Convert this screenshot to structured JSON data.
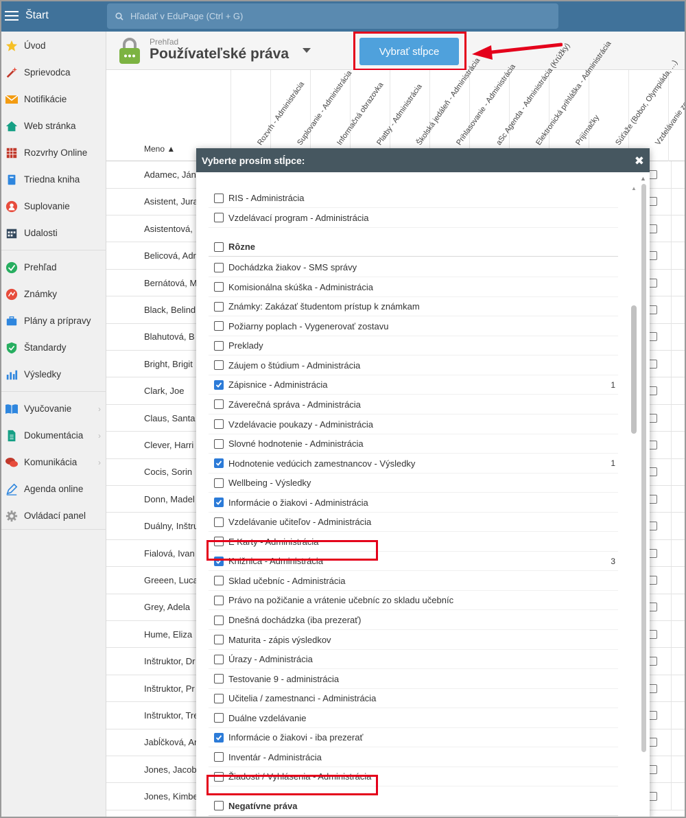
{
  "topbar": {
    "start_label": "Štart",
    "search_placeholder": "Hľadať v EduPage (Ctrl + G)"
  },
  "sidebar": {
    "items": [
      {
        "label": "Úvod",
        "icon": "star-icon"
      },
      {
        "label": "Sprievodca",
        "icon": "magic-wand-icon"
      },
      {
        "label": "Notifikácie",
        "icon": "envelope-icon"
      },
      {
        "label": "Web stránka",
        "icon": "house-icon"
      },
      {
        "label": "Rozvrhy Online",
        "icon": "timetable-icon"
      },
      {
        "label": "Triedna kniha",
        "icon": "book-icon"
      },
      {
        "label": "Suplovanie",
        "icon": "substitute-icon"
      },
      {
        "label": "Udalosti",
        "icon": "calendar-icon"
      },
      {
        "label": "Prehľad",
        "icon": "check-circle-icon"
      },
      {
        "label": "Známky",
        "icon": "grades-icon"
      },
      {
        "label": "Plány a prípravy",
        "icon": "briefcase-icon"
      },
      {
        "label": "Štandardy",
        "icon": "shield-icon"
      },
      {
        "label": "Výsledky",
        "icon": "bar-chart-icon"
      },
      {
        "label": "Vyučovanie",
        "icon": "open-book-icon",
        "chevron": true
      },
      {
        "label": "Dokumentácia",
        "icon": "document-icon",
        "chevron": true
      },
      {
        "label": "Komunikácia",
        "icon": "chat-icon",
        "chevron": true
      },
      {
        "label": "Agenda online",
        "icon": "pen-icon"
      },
      {
        "label": "Ovládací panel",
        "icon": "gear-icon"
      }
    ]
  },
  "header": {
    "breadcrumb": "Prehľad",
    "title": "Používateľské práva",
    "select_columns_button": "Vybrať stĺpce"
  },
  "table": {
    "name_header": "Meno ▲",
    "column_headers": [
      "Rozvrh - Administrácia",
      "Suplovanie - Administrácia",
      "Informačná obrazovka",
      "Platby - Administrácia",
      "Školská jedáleň - Administrácia",
      "Prihlasovanie - Administrácia",
      "aSc Agenda - Administrácia (Krúžky)",
      "Elektronická prihláška - Administrácia",
      "Prijímačky",
      "Súťaže (Bobor, Olympiáda, ...)",
      "Vzdelávanie zo školy"
    ],
    "rows": [
      "Adamec, Ján",
      "Asistent, Jura",
      "Asistentová, ",
      "Belicová, Adr",
      "Bernátová, M",
      "Black, Belind",
      "Blahutová, B",
      "Bright, Brigit",
      "Clark, Joe",
      "Claus, Santa",
      "Clever, Harri",
      "Cocis, Sorin",
      "Donn, Madel",
      "Duálny, Inštru",
      "Fialová, Ivan",
      "Greeen, Luca",
      "Grey, Adela",
      "Hume, Eliza",
      "Inštruktor, Dr",
      "Inštruktor, Pr",
      "Inštruktor, Tre",
      "Jabĺčková, An",
      "Jones, Jacob",
      "Jones, Kimbe"
    ]
  },
  "modal": {
    "title": "Vyberte prosím stĺpce:",
    "options": [
      {
        "label": "RIS - Administrácia",
        "checked": false
      },
      {
        "label": "Vzdelávací program - Administrácia",
        "checked": false
      },
      {
        "label": "Rôzne",
        "checked": false,
        "group": true
      },
      {
        "label": "Dochádzka žiakov - SMS správy",
        "checked": false
      },
      {
        "label": "Komisionálna skúška - Administrácia",
        "checked": false
      },
      {
        "label": "Známky: Zakázať študentom prístup k známkam",
        "checked": false
      },
      {
        "label": "Požiarny poplach - Vygenerovať zostavu",
        "checked": false
      },
      {
        "label": "Preklady",
        "checked": false
      },
      {
        "label": "Záujem o štúdium - Administrácia",
        "checked": false
      },
      {
        "label": "Zápisnice - Administrácia",
        "checked": true,
        "count": "1"
      },
      {
        "label": "Záverečná správa - Administrácia",
        "checked": false
      },
      {
        "label": "Vzdelávacie poukazy - Administrácia",
        "checked": false
      },
      {
        "label": "Slovné hodnotenie - Administrácia",
        "checked": false
      },
      {
        "label": "Hodnotenie vedúcich zamestnancov - Výsledky",
        "checked": true,
        "count": "1"
      },
      {
        "label": "Wellbeing - Výsledky",
        "checked": false
      },
      {
        "label": "Informácie o žiakovi - Administrácia",
        "checked": true,
        "highlight": true
      },
      {
        "label": "Vzdelávanie učiteľov - Administrácia",
        "checked": false
      },
      {
        "label": "E Karty - Administrácia",
        "checked": false
      },
      {
        "label": "Knižnica - Administrácia",
        "checked": true,
        "count": "3"
      },
      {
        "label": "Sklad učebníc - Administrácia",
        "checked": false
      },
      {
        "label": "Právo na požičanie a vrátenie učebníc zo skladu učebníc",
        "checked": false
      },
      {
        "label": "Dnešná dochádzka (iba prezerať)",
        "checked": false
      },
      {
        "label": "Maturita - zápis výsledkov",
        "checked": false
      },
      {
        "label": "Úrazy - Administrácia",
        "checked": false
      },
      {
        "label": "Testovanie 9 - administrácia",
        "checked": false
      },
      {
        "label": "Učitelia / zamestnanci - Administrácia",
        "checked": false
      },
      {
        "label": "Duálne vzdelávanie",
        "checked": false
      },
      {
        "label": "Informácie o žiakovi - iba prezerať",
        "checked": true,
        "highlight": true
      },
      {
        "label": "Inventár - Administrácia",
        "checked": false
      },
      {
        "label": "Žiadosti / Vyhlásenia - Administrácia",
        "checked": false
      },
      {
        "label": "Negatívne práva",
        "checked": false,
        "group": true
      }
    ]
  },
  "colors": {
    "topbar": "#40729a",
    "button": "#4fa1dc",
    "highlight": "#e4001b",
    "modal_header": "#465760",
    "checkbox_on": "#2c7bd8"
  }
}
